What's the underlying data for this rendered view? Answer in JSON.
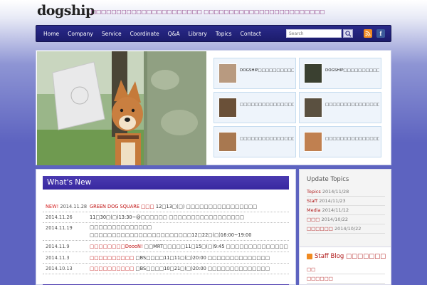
{
  "header": {
    "logo": "dogship",
    "tagline": "□□□□□□□□□□□□□□□□□□□□□□ □□□□□□□□□□□□□□□□□□□□□□□□"
  },
  "nav": {
    "items": [
      "Home",
      "Company",
      "Service",
      "Coordinate",
      "Q&A",
      "Library",
      "Topics",
      "Contact"
    ],
    "search_placeholder": "Search",
    "facebook_label": "f"
  },
  "hero": {
    "tiles": [
      {
        "text": "DOGSHIP□□□□□□□□□□□□□□□□□□□□□□□□□□",
        "thumb_color": "#b89a80"
      },
      {
        "text": "DOGSHIP□□□□□□□□□□□□□□□□□□□□□□□□",
        "thumb_color": "#3a4030"
      },
      {
        "text": "□□□□□□□□□□□□□□□□□□□□□□□□□□□□",
        "thumb_color": "#6a5038"
      },
      {
        "text": "□□□□□□□□□□□□□□□□□□□□□□□□□□□□□",
        "thumb_color": "#5a5040"
      },
      {
        "text": "□□□□□□□□□□□□□□□□□□□",
        "thumb_color": "#a87850"
      },
      {
        "text": "□□□□□□□□□□□□□□□□□□□□□□□□□□",
        "thumb_color": "#c08050"
      }
    ]
  },
  "whats_new": {
    "title": "What's New",
    "rows": [
      {
        "new": "NEW!",
        "date": "2014.11.28",
        "text_hl": "GREEN DOG SQUARE □□□",
        "text": "12□13□(□) □□□□□□□□□□□□□□□□"
      },
      {
        "new": "",
        "date": "2014.11.26",
        "text_hl": "",
        "text": "11□30□(□)13:30~@□□□□□□ □□□□□□□□□□□□□□□□□"
      },
      {
        "new": "",
        "date": "2014.11.19",
        "text_hl": "",
        "text": "□□□□□□□□□□□□□□ □□□□□□□□□□□□□□□□□□□□□□□12□22□(□)16:00~19:00 □□□□□□□□□□ □□□□□□□□□□□□□□□□□"
      },
      {
        "new": "",
        "date": "2014.11.9",
        "text_hl": "□□□□□□□□DoooN!",
        "text": "□□MRT□□□□□11□15□(□)9:45 □□□□□□□□□□□□□□"
      },
      {
        "new": "",
        "date": "2014.11.3",
        "text_hl": "□□□□□□□□□□",
        "text": "□BS□□□□11□11□(□)20:00 □□□□□□□□□□□□□□"
      },
      {
        "new": "",
        "date": "2014.10.13",
        "text_hl": "□□□□□□□□□□",
        "text": "□BS□□□□10□21□(□)20:00 □□□□□□□□□□□□□□"
      }
    ]
  },
  "sidebar": {
    "update_title": "Update Topics",
    "updates": [
      {
        "cat": "Topics",
        "date": "2014/11/28"
      },
      {
        "cat": "Staff",
        "date": "2014/11/23"
      },
      {
        "cat": "Media",
        "date": "2014/11/12"
      },
      {
        "cat": "□□□",
        "date": "2014/10/22"
      },
      {
        "cat": "□□□□□□",
        "date": "2014/10/22"
      }
    ],
    "staff_title": "Staff Blog □□□□□□□",
    "staff_items": [
      "□□",
      "□□□□□□"
    ]
  },
  "colors": {
    "nav_bg": "#1c1c6c",
    "news_title_bg": "#3828a0",
    "accent_red": "#c01010",
    "rss": "#f08a22",
    "facebook": "#3b5a9a"
  }
}
